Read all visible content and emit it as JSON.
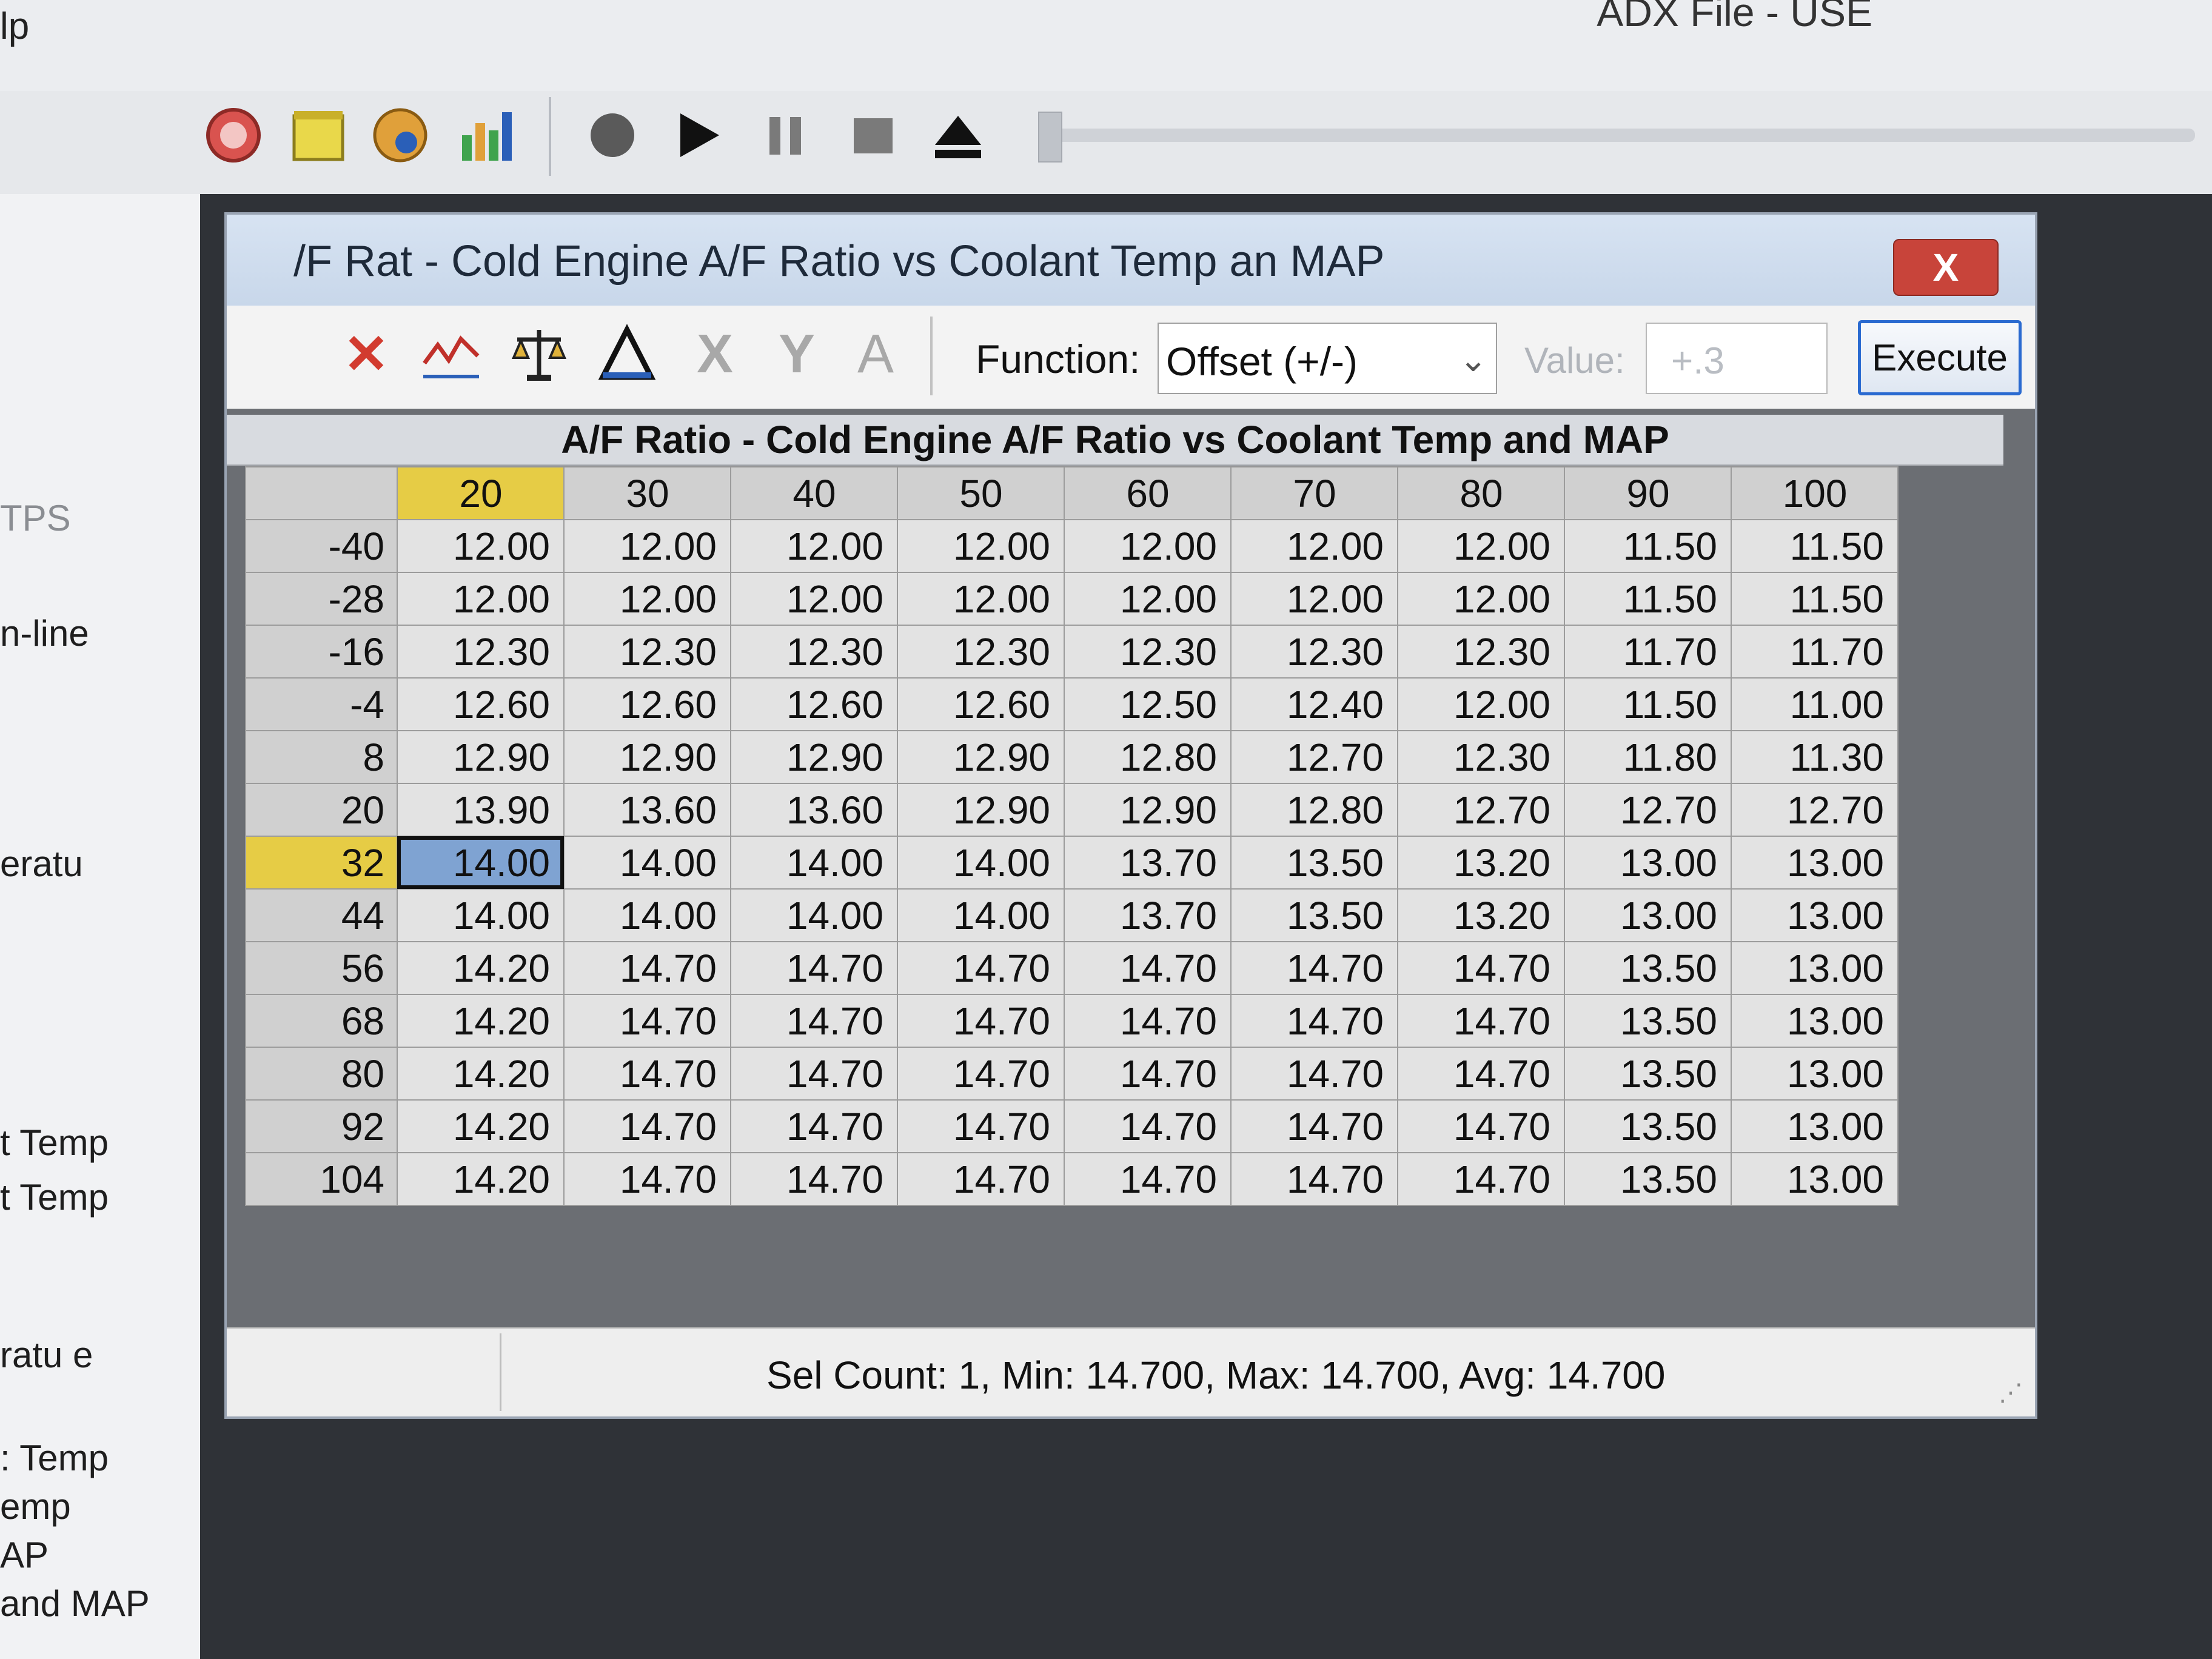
{
  "app": {
    "menu_help": "lp",
    "title": "ADX File - USE"
  },
  "left_panel": {
    "items": [
      "TPS",
      "n-line",
      "eratu",
      "t Temp",
      "t Temp",
      "ratu e",
      ": Temp",
      "emp",
      "AP",
      "and MAP"
    ]
  },
  "dialog": {
    "title": "/F Rat  - Cold Engine A/F Ratio vs Coolant Temp an  MAP",
    "close_label": "X",
    "toolbar": {
      "function_label": "Function:",
      "function_value": "Offset (+/-)",
      "value_label": "Value:",
      "value_text": "+.3",
      "execute_label": "Execute"
    },
    "grid": {
      "title": "A/F Ratio - Cold Engine A/F Ratio vs Coolant Temp and MAP",
      "columns": [
        "20",
        "30",
        "40",
        "50",
        "60",
        "70",
        "80",
        "90",
        "100"
      ],
      "highlight_col": "20",
      "rows": [
        {
          "label": "-40",
          "cells": [
            "12.00",
            "12.00",
            "12.00",
            "12.00",
            "12.00",
            "12.00",
            "12.00",
            "11.50",
            "11.50"
          ]
        },
        {
          "label": "-28",
          "cells": [
            "12.00",
            "12.00",
            "12.00",
            "12.00",
            "12.00",
            "12.00",
            "12.00",
            "11.50",
            "11.50"
          ]
        },
        {
          "label": "-16",
          "cells": [
            "12.30",
            "12.30",
            "12.30",
            "12.30",
            "12.30",
            "12.30",
            "12.30",
            "11.70",
            "11.70"
          ]
        },
        {
          "label": "-4",
          "cells": [
            "12.60",
            "12.60",
            "12.60",
            "12.60",
            "12.50",
            "12.40",
            "12.00",
            "11.50",
            "11.00"
          ]
        },
        {
          "label": "8",
          "cells": [
            "12.90",
            "12.90",
            "12.90",
            "12.90",
            "12.80",
            "12.70",
            "12.30",
            "11.80",
            "11.30"
          ]
        },
        {
          "label": "20",
          "cells": [
            "13.90",
            "13.60",
            "13.60",
            "12.90",
            "12.90",
            "12.80",
            "12.70",
            "12.70",
            "12.70"
          ]
        },
        {
          "label": "32",
          "cells": [
            "14.00",
            "14.00",
            "14.00",
            "14.00",
            "13.70",
            "13.50",
            "13.20",
            "13.00",
            "13.00"
          ]
        },
        {
          "label": "44",
          "cells": [
            "14.00",
            "14.00",
            "14.00",
            "14.00",
            "13.70",
            "13.50",
            "13.20",
            "13.00",
            "13.00"
          ]
        },
        {
          "label": "56",
          "cells": [
            "14.20",
            "14.70",
            "14.70",
            "14.70",
            "14.70",
            "14.70",
            "14.70",
            "13.50",
            "13.00"
          ]
        },
        {
          "label": "68",
          "cells": [
            "14.20",
            "14.70",
            "14.70",
            "14.70",
            "14.70",
            "14.70",
            "14.70",
            "13.50",
            "13.00"
          ]
        },
        {
          "label": "80",
          "cells": [
            "14.20",
            "14.70",
            "14.70",
            "14.70",
            "14.70",
            "14.70",
            "14.70",
            "13.50",
            "13.00"
          ]
        },
        {
          "label": "92",
          "cells": [
            "14.20",
            "14.70",
            "14.70",
            "14.70",
            "14.70",
            "14.70",
            "14.70",
            "13.50",
            "13.00"
          ]
        },
        {
          "label": "104",
          "cells": [
            "14.20",
            "14.70",
            "14.70",
            "14.70",
            "14.70",
            "14.70",
            "14.70",
            "13.50",
            "13.00"
          ]
        }
      ],
      "highlight_row": "32",
      "selected_cell": {
        "row": "32",
        "col": "20"
      }
    },
    "status": "Sel Count: 1, Min: 14.700, Max: 14.700, Avg: 14.700"
  },
  "colors": {
    "highlight_header": "#e6cc45",
    "selected_cell": "#7fa3d2",
    "close_button": "#c8443a",
    "execute_border": "#2a6ad0"
  },
  "icons": {
    "main_toolbar": [
      "gauge-icon",
      "notepad-icon",
      "compass-icon",
      "bar-chart-icon",
      "record-icon",
      "play-icon",
      "pause-icon",
      "stop-icon",
      "eject-icon"
    ],
    "dialog_toolbar": [
      "delete-icon",
      "graph-icon",
      "balance-icon",
      "triangle-icon",
      "cut-icon",
      "interpolate-icon",
      "text-icon"
    ]
  }
}
